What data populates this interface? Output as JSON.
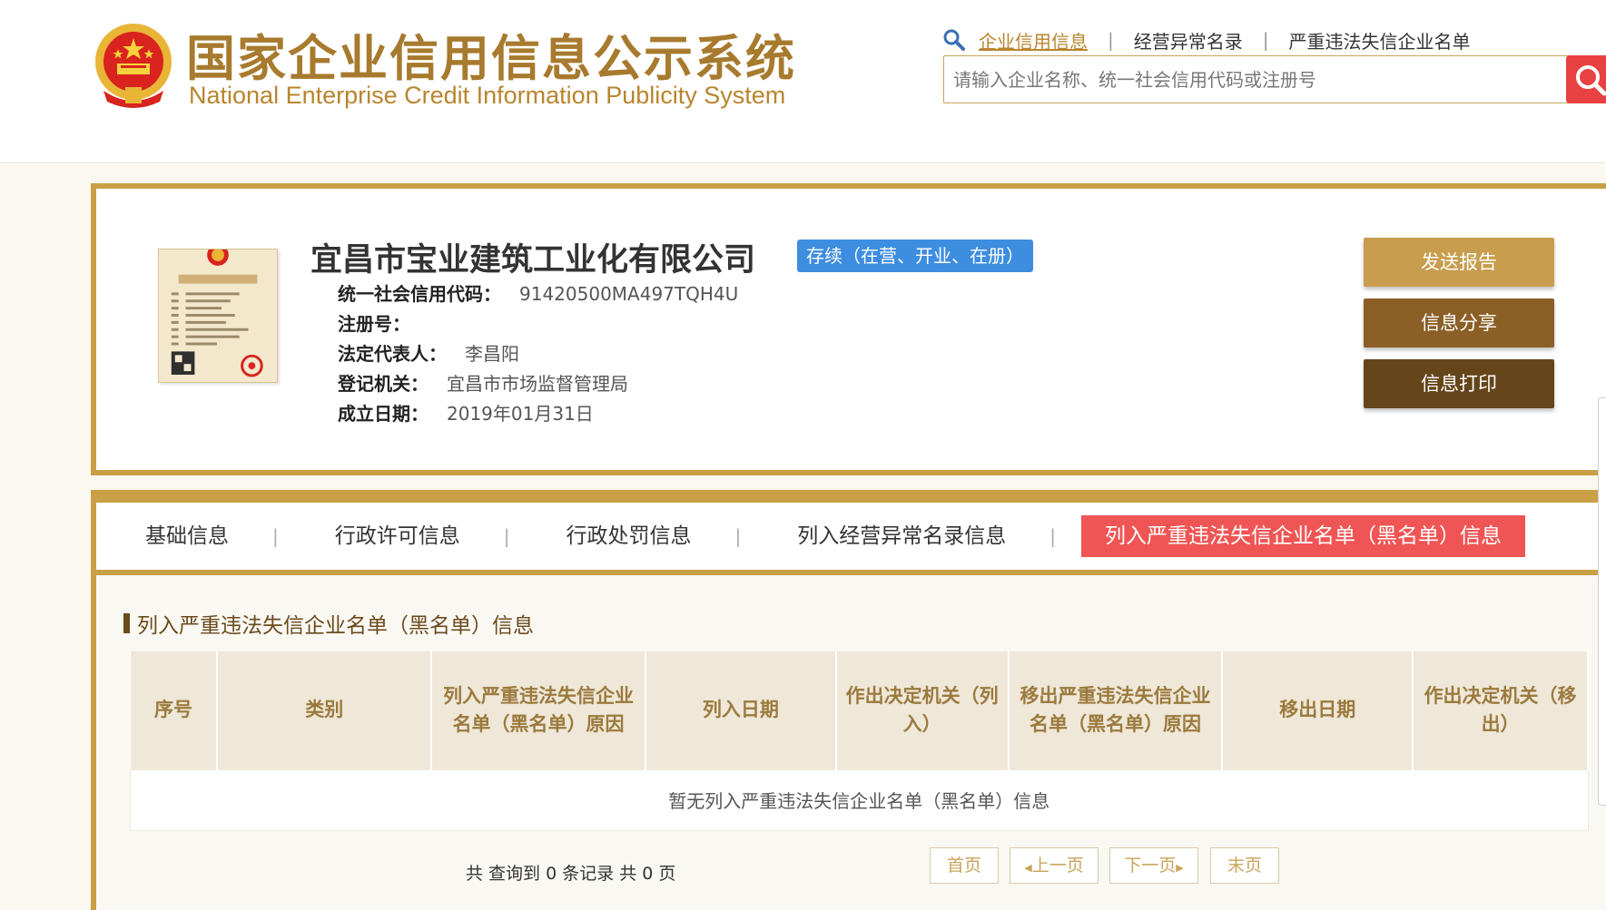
{
  "header": {
    "title_cn": "国家企业信用信息公示系统",
    "title_en": "National Enterprise Credit Information Publicity System",
    "nav": [
      {
        "label": "企业信用信息",
        "active": true
      },
      {
        "label": "经营异常名录",
        "active": false
      },
      {
        "label": "严重违法失信企业名单",
        "active": false
      }
    ],
    "nav_separator": "|",
    "search": {
      "placeholder": "请输入企业名称、统一社会信用代码或注册号",
      "value": ""
    },
    "icons": {
      "nav": "search-icon",
      "search_button": "search-icon",
      "logo": "national-emblem-icon"
    }
  },
  "company": {
    "name": "宜昌市宝业建筑工业化有限公司",
    "status": "存续（在营、开业、在册）",
    "fields": [
      {
        "label": "统一社会信用代码：",
        "value": "91420500MA497TQH4U"
      },
      {
        "label": "注册号：",
        "value": ""
      },
      {
        "label": "法定代表人：",
        "value": "李昌阳"
      },
      {
        "label": "登记机关：",
        "value": "宜昌市市场监督管理局"
      },
      {
        "label": "成立日期：",
        "value": "2019年01月31日"
      }
    ],
    "license_icon": "business-license-icon"
  },
  "actions": {
    "send_report": "发送报告",
    "share": "信息分享",
    "print": "信息打印"
  },
  "tabs": [
    {
      "label": "基础信息",
      "active": false
    },
    {
      "label": "行政许可信息",
      "active": false
    },
    {
      "label": "行政处罚信息",
      "active": false
    },
    {
      "label": "列入经营异常名录信息",
      "active": false
    },
    {
      "label": "列入严重违法失信企业名单（黑名单）信息",
      "active": true
    }
  ],
  "section": {
    "title": "列入严重违法失信企业名单（黑名单）信息",
    "table": {
      "headers": [
        "序号",
        "类别",
        "列入严重违法失信企业名单（黑名单）原因",
        "列入日期",
        "作出决定机关（列入）",
        "移出严重违法失信企业名单（黑名单）原因",
        "移出日期",
        "作出决定机关（移出）"
      ],
      "empty_text": "暂无列入严重违法失信企业名单（黑名单）信息"
    }
  },
  "pagination": {
    "summary": "共 查询到 0 条记录 共 0 页",
    "first": "首页",
    "prev": "上一页",
    "next": "下一页",
    "last": "末页"
  },
  "colors": {
    "gold": "#c9a045",
    "title_gold": "#a77a2e",
    "status_blue": "#3d8de0",
    "active_tab_red": "#ef5554",
    "search_red": "#e84141"
  }
}
